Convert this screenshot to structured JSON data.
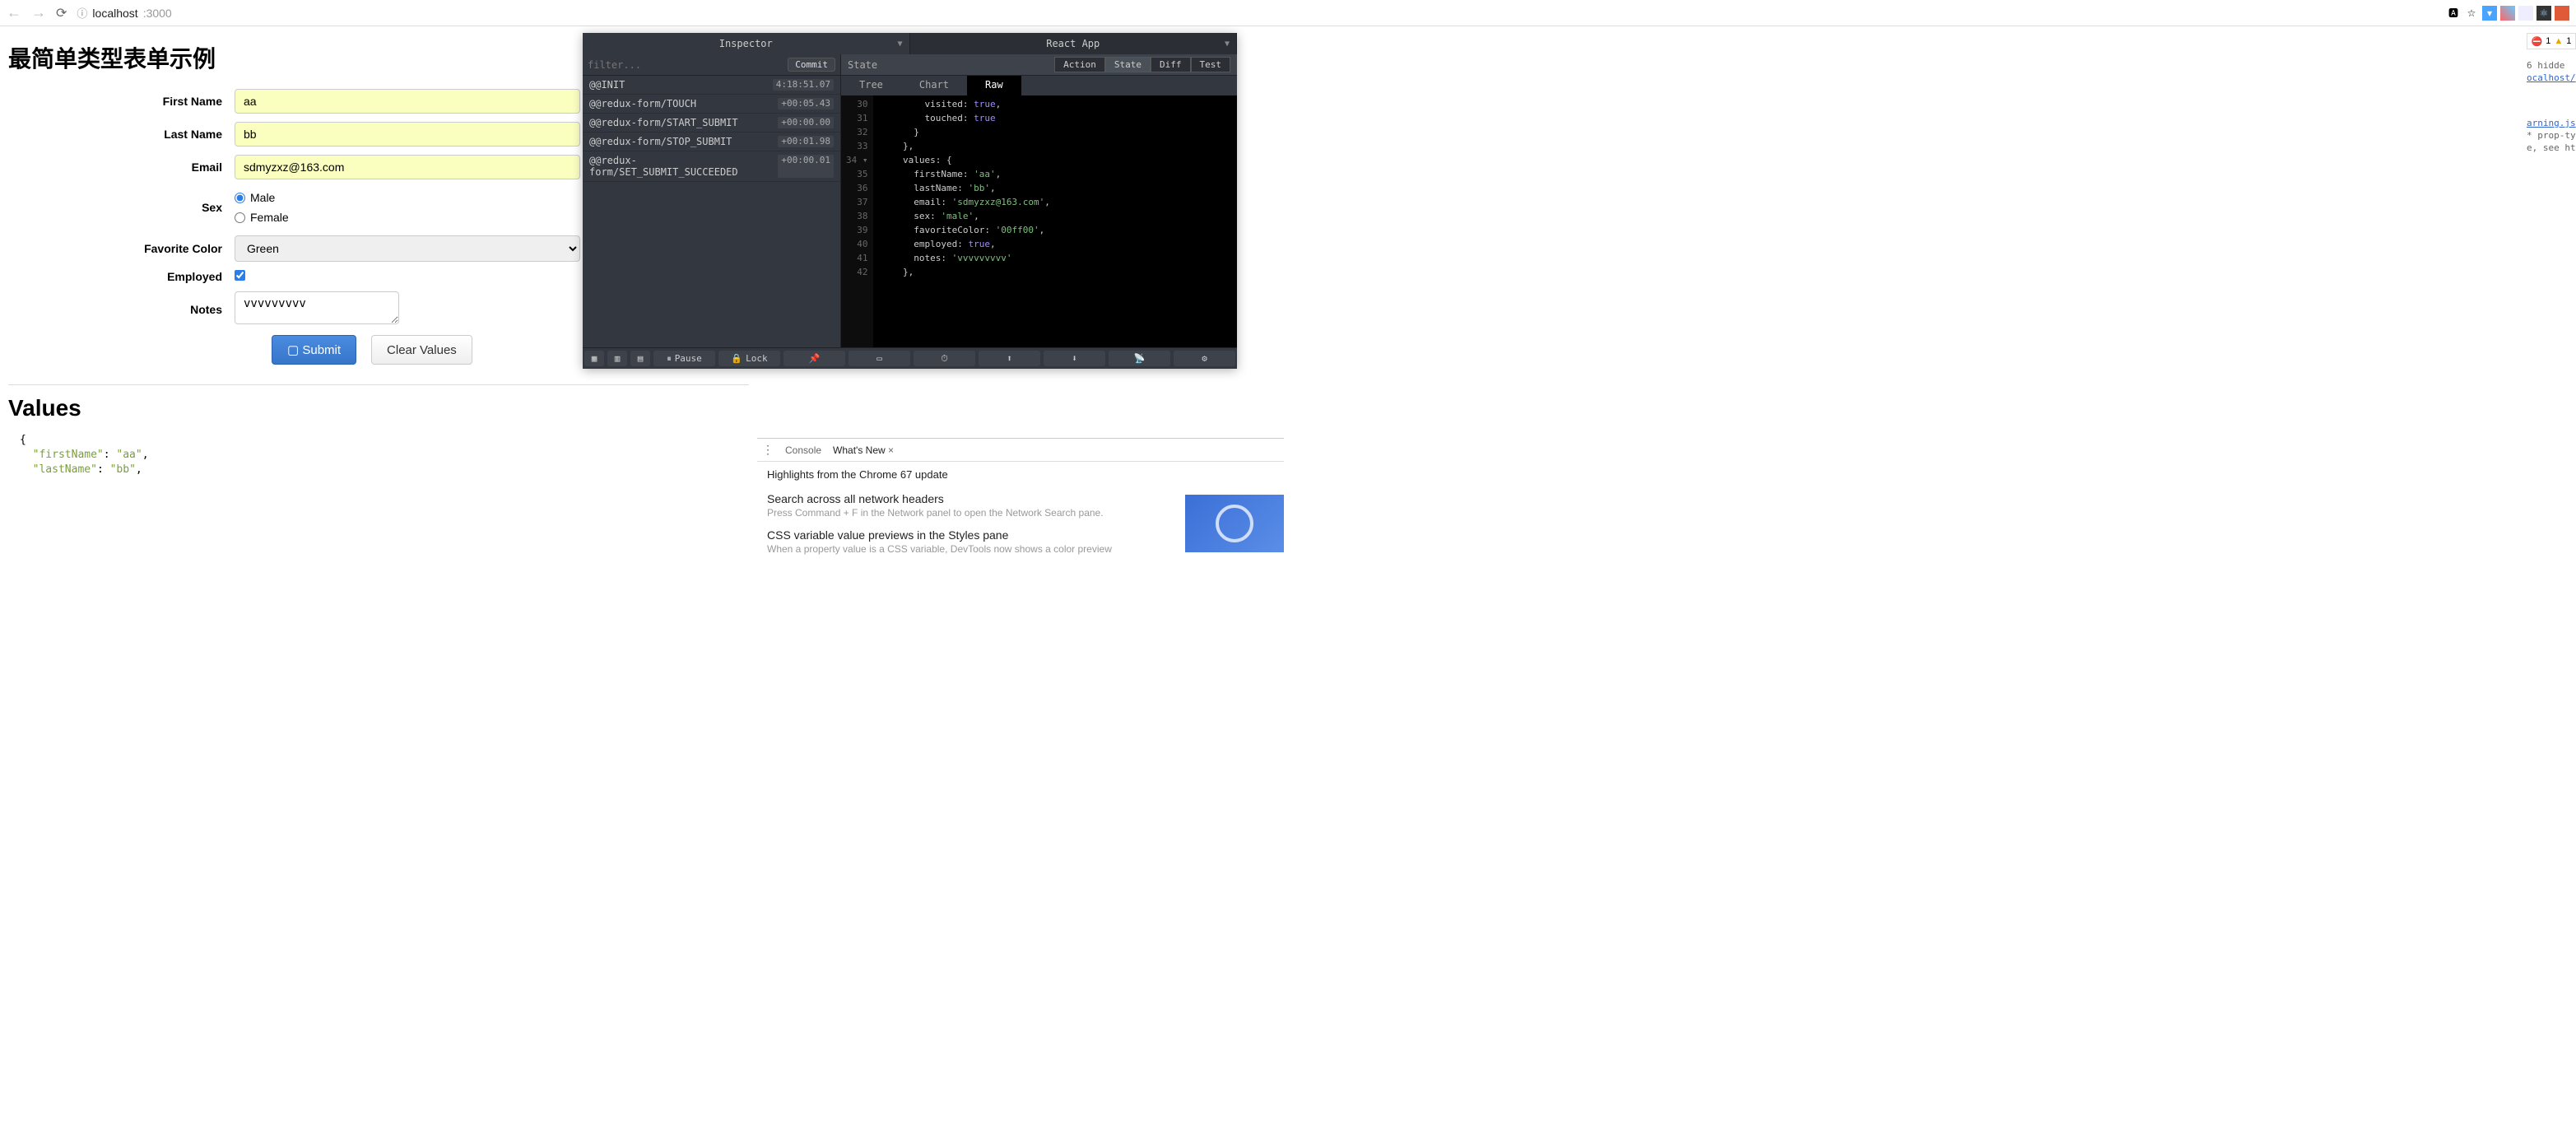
{
  "browser": {
    "url_host": "localhost",
    "url_port": ":3000",
    "ext_translate": "⌨",
    "ext_star": "☆",
    "errors_red": "1",
    "errors_yellow": "1"
  },
  "page": {
    "title": "最简单类型表单示例",
    "labels": {
      "firstName": "First Name",
      "lastName": "Last Name",
      "email": "Email",
      "sex": "Sex",
      "favoriteColor": "Favorite Color",
      "employed": "Employed",
      "notes": "Notes"
    },
    "values": {
      "firstName": "aa",
      "lastName": "bb",
      "email": "sdmyzxz@163.com",
      "sexMale": "Male",
      "sexFemale": "Female",
      "favoriteColor": "Green",
      "notes": "vvvvvvvvv"
    },
    "buttons": {
      "submit": "Submit",
      "clear": "Clear Values"
    },
    "valuesHeading": "Values",
    "json": {
      "firstName_k": "\"firstName\"",
      "firstName_v": "\"aa\"",
      "lastName_k": "\"lastName\"",
      "lastName_v": "\"bb\""
    }
  },
  "reduxDevtools": {
    "tabs": {
      "inspector": "Inspector",
      "reactApp": "React App"
    },
    "filterPlaceholder": "filter...",
    "commit": "Commit",
    "actions": [
      {
        "name": "@@INIT",
        "time": "4:18:51.07"
      },
      {
        "name": "@@redux-form/TOUCH",
        "time": "+00:05.43"
      },
      {
        "name": "@@redux-form/START_SUBMIT",
        "time": "+00:00.00"
      },
      {
        "name": "@@redux-form/STOP_SUBMIT",
        "time": "+00:01.98"
      },
      {
        "name": "@@redux-form/SET_SUBMIT_SUCCEEDED",
        "time": "+00:00.01"
      }
    ],
    "stateLabel": "State",
    "stateButtons": {
      "action": "Action",
      "state": "State",
      "diff": "Diff",
      "test": "Test"
    },
    "subtabs": {
      "tree": "Tree",
      "chart": "Chart",
      "raw": "Raw"
    },
    "code": {
      "lines": [
        "30",
        "31",
        "32",
        "33",
        "34 ▾",
        "35",
        "36",
        "37",
        "38",
        "39",
        "40",
        "41",
        "42"
      ],
      "l30": {
        "prop": "visited:",
        "val": "true",
        "tail": ","
      },
      "l31": {
        "prop": "touched:",
        "val": "true"
      },
      "l32": "}",
      "l33": "},",
      "l34": {
        "prop": "values:",
        "brace": "{"
      },
      "l35": {
        "prop": "firstName:",
        "val": "'aa'",
        "tail": ","
      },
      "l36": {
        "prop": "lastName:",
        "val": "'bb'",
        "tail": ","
      },
      "l37": {
        "prop": "email:",
        "val": "'sdmyzxz@163.com'",
        "tail": ","
      },
      "l38": {
        "prop": "sex:",
        "val": "'male'",
        "tail": ","
      },
      "l39": {
        "prop": "favoriteColor:",
        "val": "'00ff00'",
        "tail": ","
      },
      "l40": {
        "prop": "employed:",
        "val": "true",
        "tail": ","
      },
      "l41": {
        "prop": "notes:",
        "val": "'vvvvvvvvv'"
      },
      "l42": "},"
    },
    "toolbar": {
      "pause": "Pause",
      "lock": "Lock"
    }
  },
  "consoleTrunc": {
    "l1": "6 hidde",
    "l2": "ocalhost/",
    "l3": "arning.js",
    "l4": "* prop-ty",
    "l5": "e, see ht"
  },
  "devtoolsBottom": {
    "tabs": {
      "console": "Console",
      "whatsnew": "What's New"
    },
    "highlights": "Highlights from the Chrome 67 update",
    "item1_h": "Search across all network headers",
    "item1_p": "Press Command + F in the Network panel to open the Network Search pane.",
    "item2_h": "CSS variable value previews in the Styles pane",
    "item2_p": "When a property value is a CSS variable, DevTools now shows a color preview"
  }
}
